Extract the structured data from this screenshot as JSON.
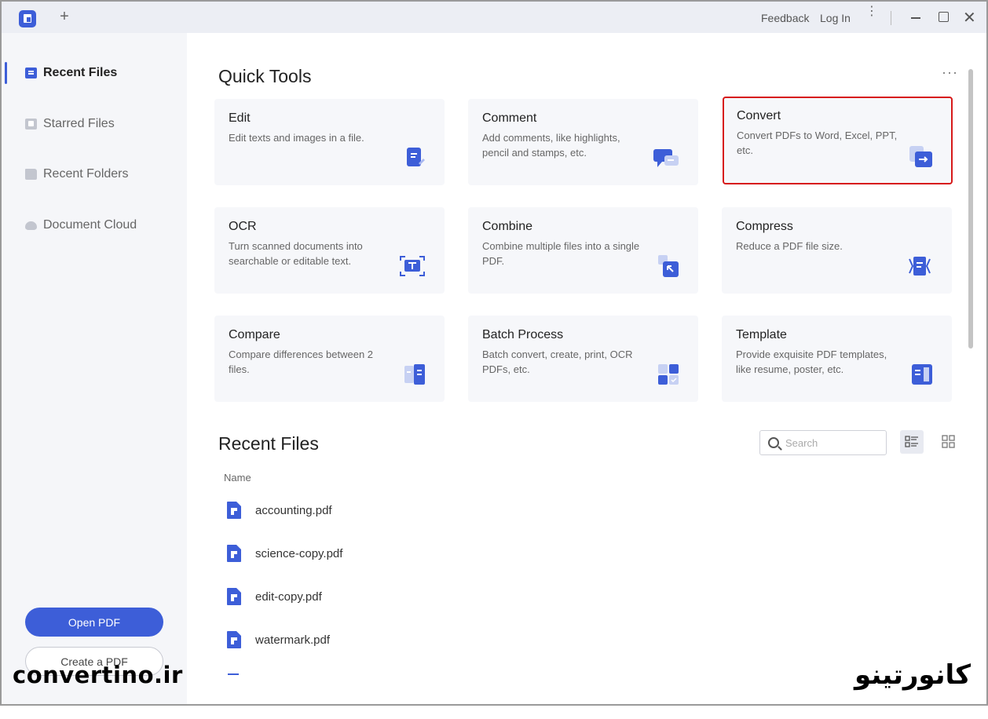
{
  "titlebar": {
    "tab_add": "+",
    "feedback": "Feedback",
    "login": "Log In",
    "more": "⋮",
    "close": "✕"
  },
  "sidebar": {
    "items": [
      {
        "label": "Recent Files",
        "icon": "recent-files-icon",
        "active": true
      },
      {
        "label": "Starred Files",
        "icon": "star-icon",
        "active": false
      },
      {
        "label": "Recent Folders",
        "icon": "folder-icon",
        "active": false
      },
      {
        "label": "Document Cloud",
        "icon": "cloud-icon",
        "active": false
      }
    ],
    "open_pdf": "Open PDF",
    "create_pdf": "Create a PDF"
  },
  "quick_tools": {
    "title": "Quick Tools",
    "more": "···",
    "tools": [
      {
        "title": "Edit",
        "desc": "Edit texts and images in a file.",
        "icon": "edit-icon"
      },
      {
        "title": "Comment",
        "desc": "Add comments, like highlights, pencil and stamps, etc.",
        "icon": "comment-icon"
      },
      {
        "title": "Convert",
        "desc": "Convert PDFs to Word, Excel, PPT, etc.",
        "icon": "convert-icon",
        "selected": true
      },
      {
        "title": "OCR",
        "desc": "Turn scanned documents into searchable or editable text.",
        "icon": "ocr-icon"
      },
      {
        "title": "Combine",
        "desc": "Combine multiple files into a single PDF.",
        "icon": "combine-icon"
      },
      {
        "title": "Compress",
        "desc": "Reduce a PDF file size.",
        "icon": "compress-icon"
      },
      {
        "title": "Compare",
        "desc": "Compare differences between 2 files.",
        "icon": "compare-icon"
      },
      {
        "title": "Batch Process",
        "desc": "Batch convert, create, print, OCR PDFs, etc.",
        "icon": "batch-icon"
      },
      {
        "title": "Template",
        "desc": "Provide exquisite PDF templates, like resume, poster, etc.",
        "icon": "template-icon"
      }
    ]
  },
  "recent_files": {
    "title": "Recent Files",
    "search_placeholder": "Search",
    "column_name": "Name",
    "files": [
      "accounting.pdf",
      "science-copy.pdf",
      "edit-copy.pdf",
      "watermark.pdf"
    ]
  },
  "colors": {
    "accent": "#3d5ed8",
    "selection_border": "#d71a1a"
  },
  "watermarks": {
    "left": "convertino.ir",
    "right": "کانورتینو"
  }
}
